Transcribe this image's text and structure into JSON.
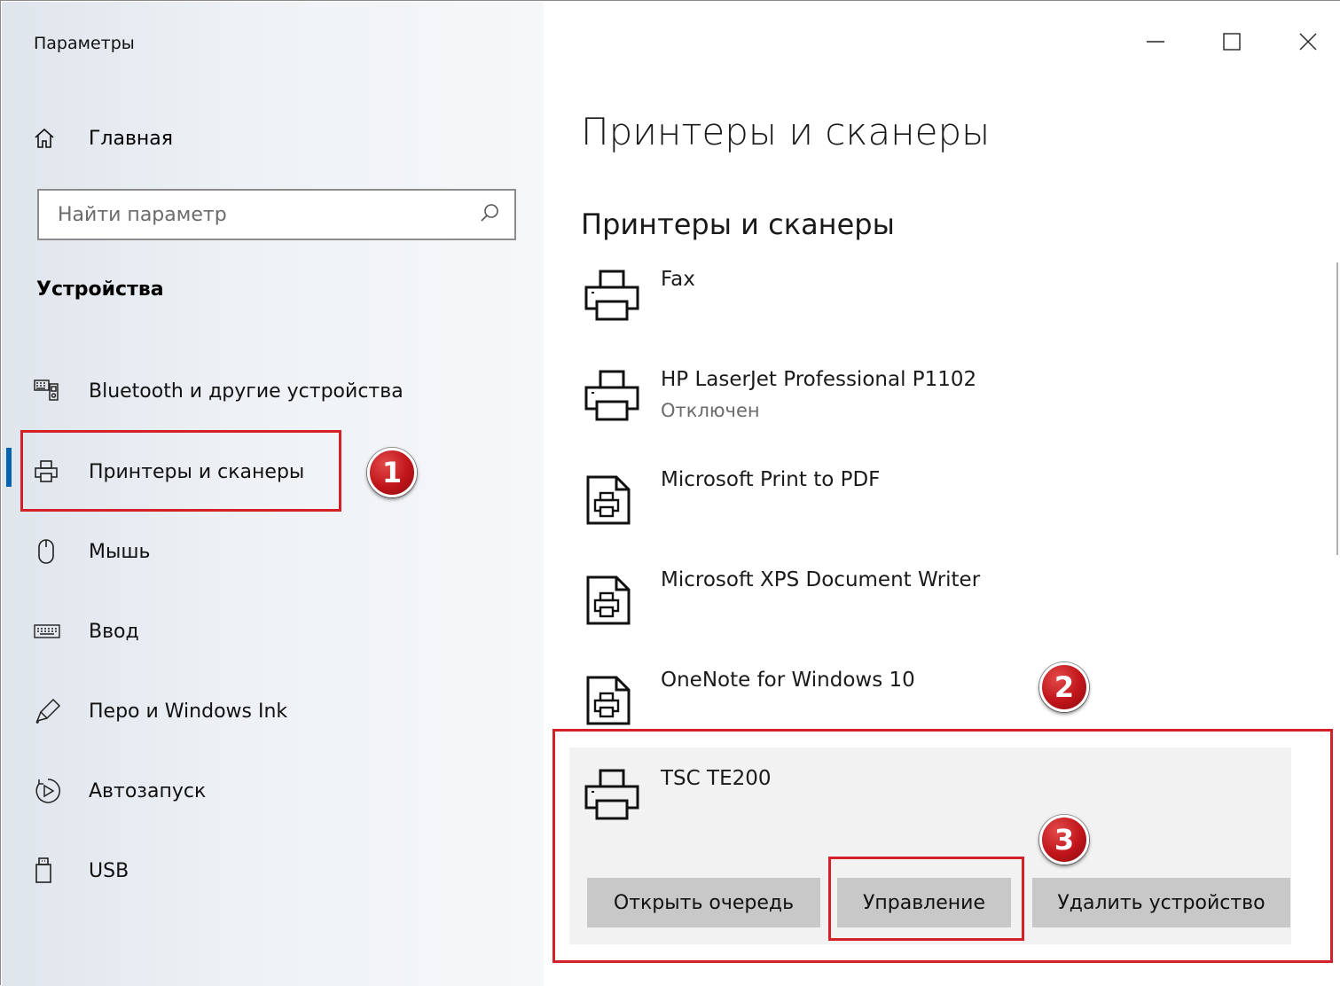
{
  "window": {
    "title": "Параметры",
    "controls": {
      "minimize": "—",
      "maximize": "☐",
      "close": "✕"
    }
  },
  "sidebar": {
    "home_label": "Главная",
    "search_placeholder": "Найти параметр",
    "section_title": "Устройства",
    "items": [
      {
        "label": "Bluetooth и другие устройства",
        "icon": "bluetooth-devices-icon"
      },
      {
        "label": "Принтеры и сканеры",
        "icon": "printer-icon",
        "active": true
      },
      {
        "label": "Мышь",
        "icon": "mouse-icon"
      },
      {
        "label": "Ввод",
        "icon": "keyboard-icon"
      },
      {
        "label": "Перо и Windows Ink",
        "icon": "pen-icon"
      },
      {
        "label": "Автозапуск",
        "icon": "autoplay-icon"
      },
      {
        "label": "USB",
        "icon": "usb-icon"
      }
    ]
  },
  "main": {
    "title": "Принтеры и сканеры",
    "subtitle": "Принтеры и сканеры",
    "devices": [
      {
        "name": "Fax",
        "status": "",
        "icon": "printer-icon"
      },
      {
        "name": "HP LaserJet Professional P1102",
        "status": "Отключен",
        "icon": "printer-icon"
      },
      {
        "name": "Microsoft Print to PDF",
        "status": "",
        "icon": "virtual-printer-icon"
      },
      {
        "name": "Microsoft XPS Document Writer",
        "status": "",
        "icon": "virtual-printer-icon"
      },
      {
        "name": "OneNote for Windows 10",
        "status": "",
        "icon": "virtual-printer-icon"
      }
    ],
    "selected_device": {
      "name": "TSC TE200",
      "icon": "printer-icon",
      "buttons": {
        "open_queue": "Открыть очередь",
        "manage": "Управление",
        "remove": "Удалить устройство"
      }
    }
  },
  "annotations": {
    "badge_1": "1",
    "badge_2": "2",
    "badge_3": "3",
    "callout_color": "#d42027"
  },
  "colors": {
    "accent": "#0063b1",
    "sidebar_bg": "#e6ebf1",
    "button_bg": "#c8c8c8",
    "selected_bg": "#f2f2f2"
  }
}
